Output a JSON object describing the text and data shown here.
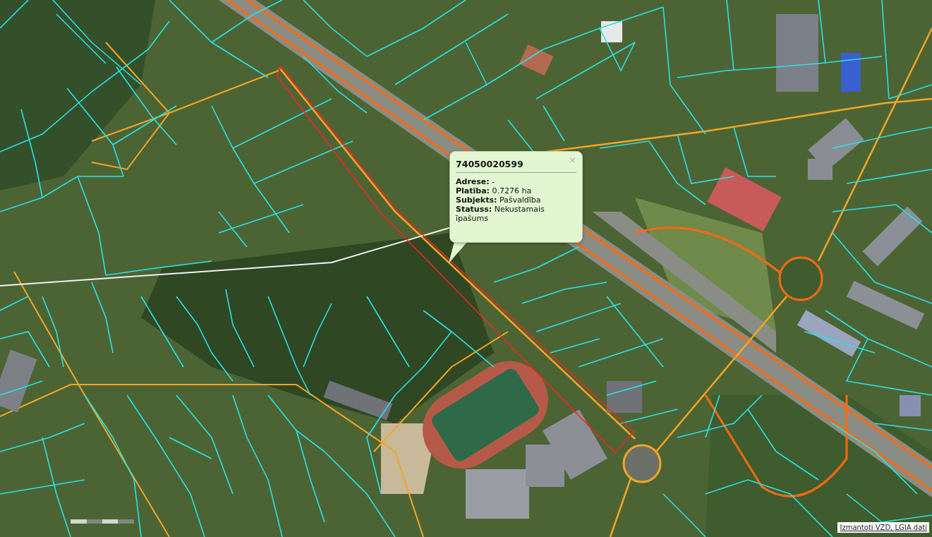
{
  "map": {
    "popup": {
      "title": "74050020599",
      "close": "×",
      "fields": [
        {
          "label": "Adrese:",
          "value": "-"
        },
        {
          "label": "Platība:",
          "value": "0.7276 ha"
        },
        {
          "label": "Subjekts:",
          "value": "Pašvaldība"
        },
        {
          "label": "Statuss:",
          "value": "Nekustamais īpašums"
        }
      ]
    },
    "attribution": "Izmantoti VZD, LGIA dati"
  }
}
